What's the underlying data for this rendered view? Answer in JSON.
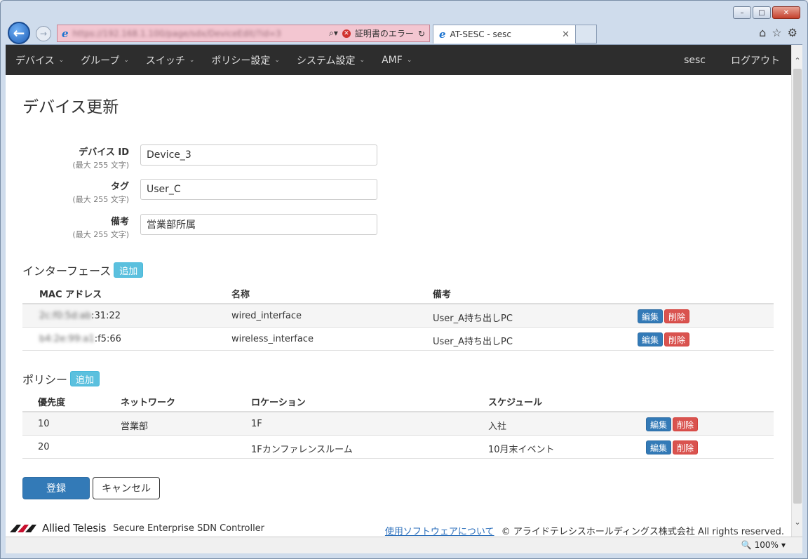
{
  "browser": {
    "url": "https://192.168.1.100/page/sdx/DeviceEdit/?id=3",
    "cert_error": "証明書のエラー",
    "tab_title": "AT-SESC - sesc",
    "zoom": "100%"
  },
  "navbar": {
    "items": [
      {
        "label": "デバイス"
      },
      {
        "label": "グループ"
      },
      {
        "label": "スイッチ"
      },
      {
        "label": "ポリシー設定"
      },
      {
        "label": "システム設定"
      },
      {
        "label": "AMF"
      }
    ],
    "user": "sesc",
    "logout": "ログアウト"
  },
  "page": {
    "title": "デバイス更新"
  },
  "form": {
    "device_id": {
      "label": "デバイス ID",
      "hint": "(最大 255 文字)",
      "value": "Device_3"
    },
    "tag": {
      "label": "タグ",
      "hint": "(最大 255 文字)",
      "value": "User_C"
    },
    "note": {
      "label": "備考",
      "hint": "(最大 255 文字)",
      "value": "営業部所属"
    }
  },
  "interfaces": {
    "title": "インターフェース",
    "add": "追加",
    "headers": {
      "mac": "MAC アドレス",
      "name": "名称",
      "note": "備考"
    },
    "rows": [
      {
        "mac_hidden": "2c:f0:5d:ab",
        "mac_tail": ":31:22",
        "name": "wired_interface",
        "note": "User_A持ち出しPC",
        "edit": "編集",
        "delete": "削除"
      },
      {
        "mac_hidden": "b4:2e:99:a1",
        "mac_tail": ":f5:66",
        "name": "wireless_interface",
        "note": "User_A持ち出しPC",
        "edit": "編集",
        "delete": "削除"
      }
    ]
  },
  "policies": {
    "title": "ポリシー",
    "add": "追加",
    "headers": {
      "priority": "優先度",
      "network": "ネットワーク",
      "location": "ロケーション",
      "schedule": "スケジュール"
    },
    "rows": [
      {
        "priority": "10",
        "network": "営業部",
        "location": "1F",
        "schedule": "入社",
        "edit": "編集",
        "delete": "削除"
      },
      {
        "priority": "20",
        "network": "",
        "location": "1Fカンファレンスルーム",
        "schedule": "10月末イベント",
        "edit": "編集",
        "delete": "削除"
      }
    ]
  },
  "actions": {
    "submit": "登録",
    "cancel": "キャンセル"
  },
  "footer": {
    "brand": "Allied Telesis",
    "product": "Secure Enterprise SDN Controller",
    "link": "使用ソフトウェアについて",
    "copyright": "© アライドテレシスホールディングス株式会社 All rights reserved."
  },
  "colors": {
    "navbar": "#2d2d2d",
    "primary": "#337ab7",
    "danger": "#d9534f",
    "info": "#5bc0de"
  }
}
